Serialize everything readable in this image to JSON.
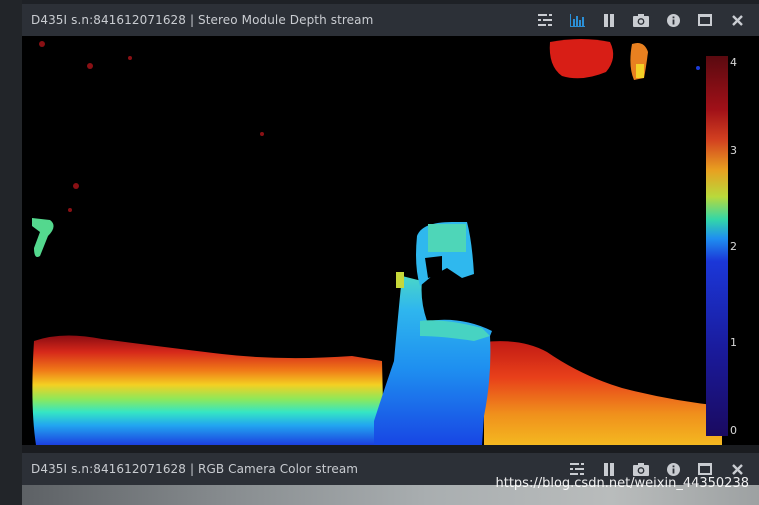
{
  "top_window": {
    "title": "D435I s.n:841612071628 | Stereo Module Depth stream",
    "toolbar": [
      {
        "name": "options-icon",
        "tooltip": "options"
      },
      {
        "name": "histogram-icon",
        "tooltip": "metadata"
      },
      {
        "name": "pause-icon",
        "tooltip": "pause"
      },
      {
        "name": "camera-icon",
        "tooltip": "snapshot"
      },
      {
        "name": "info-icon",
        "tooltip": "info"
      },
      {
        "name": "maximize-icon",
        "tooltip": "maximize"
      },
      {
        "name": "close-icon",
        "tooltip": "close"
      }
    ],
    "colorbar_labels": [
      "4",
      "3",
      "2",
      "1",
      "0"
    ]
  },
  "bottom_window": {
    "title": "D435I s.n:841612071628 | RGB Camera Color stream",
    "toolbar": [
      {
        "name": "options-icon"
      },
      {
        "name": "pause-icon"
      },
      {
        "name": "camera-icon"
      },
      {
        "name": "info-icon"
      },
      {
        "name": "maximize-icon"
      },
      {
        "name": "close-icon"
      }
    ]
  },
  "watermark": "https://blog.csdn.net/weixin_44350238",
  "colors": {
    "titlebar": "#2c3037",
    "title_text": "#c9ccd1",
    "icon": "#c9ccd1",
    "active_icon": "#2b8fd6",
    "background": "#1e2126"
  }
}
